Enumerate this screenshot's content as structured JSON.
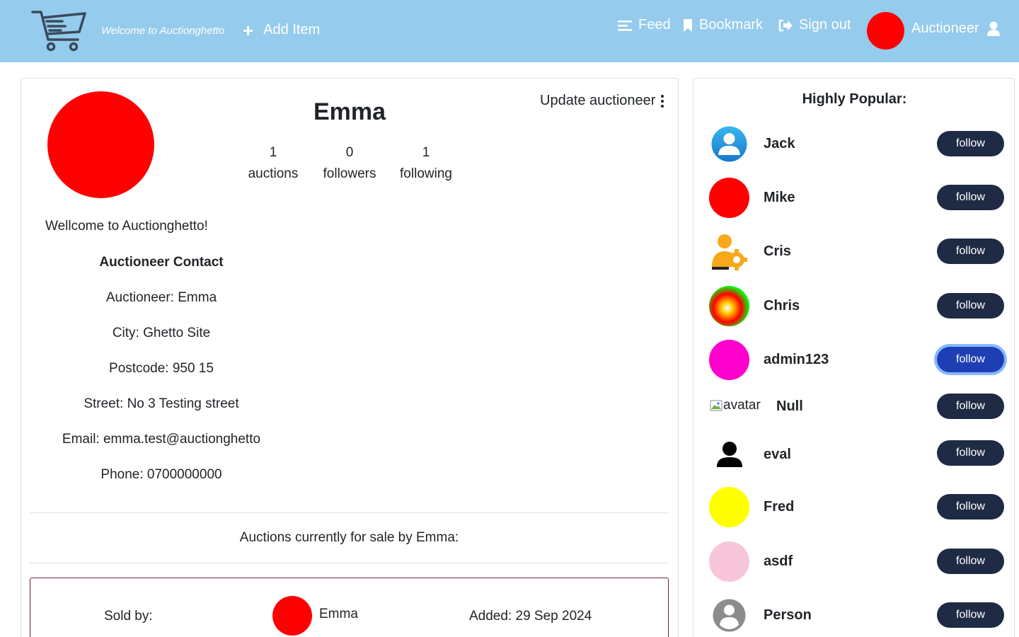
{
  "navbar": {
    "welcome": "Welcome to Auctionghetto",
    "add_item": "Add Item",
    "feed": "Feed",
    "bookmark": "Bookmark",
    "sign_out": "Sign out",
    "user": "Auctioneer"
  },
  "profile": {
    "name": "Emma",
    "update_label": "Update auctioneer",
    "stats": [
      {
        "value": "1",
        "label": "auctions"
      },
      {
        "value": "0",
        "label": "followers"
      },
      {
        "value": "1",
        "label": "following"
      }
    ],
    "about": "Wellcome to Auctionghetto!",
    "contact_title": "Auctioneer Contact",
    "auctioneer": "Auctioneer: Emma",
    "city": "City: Ghetto Site",
    "postcode": "Postcode: 950 15",
    "street": "Street: No 3 Testing street",
    "email": "Email: emma.test@auctionghetto",
    "phone": "Phone: 0700000000"
  },
  "auctions": {
    "heading": "Auctions currently for sale by Emma:",
    "sold_by_label": "Sold by:",
    "seller": "Emma",
    "added": "Added: 29 Sep 2024"
  },
  "sidebar": {
    "title": "Highly Popular:",
    "follow_label": "follow",
    "broken_alt": "avatar",
    "users": [
      {
        "name": "Jack",
        "avatar": "default-user-icon"
      },
      {
        "name": "Mike",
        "avatar_color": "#ff0000"
      },
      {
        "name": "Cris",
        "avatar": "user-gear-icon"
      },
      {
        "name": "Chris",
        "avatar": "rainbow-gradient"
      },
      {
        "name": "admin123",
        "avatar_color": "#ff00cc"
      },
      {
        "name": "Null",
        "avatar": "broken-image"
      },
      {
        "name": "eval",
        "avatar": "person-silhouette-icon"
      },
      {
        "name": "Fred",
        "avatar_color": "#ffff00"
      },
      {
        "name": "asdf",
        "avatar_color": "#f7c6da"
      },
      {
        "name": "Person",
        "avatar": "grey-user-icon"
      }
    ]
  },
  "colors": {
    "navbar_bg": "#95cbec",
    "button_dark": "#1f2a44",
    "button_active": "#1d3fb3"
  }
}
